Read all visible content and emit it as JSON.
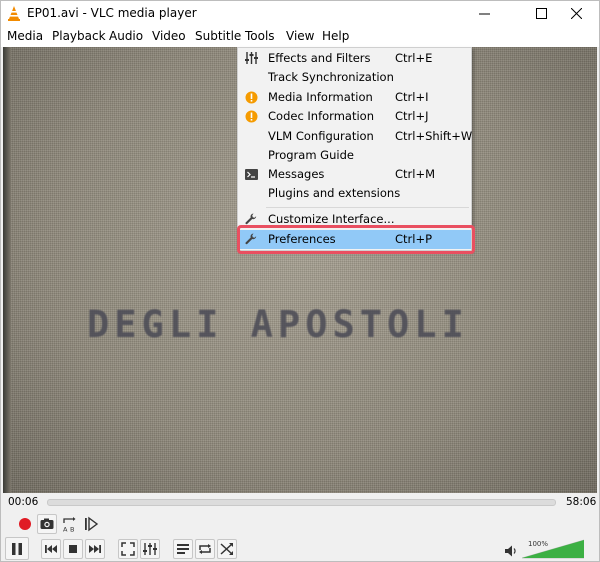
{
  "window": {
    "title": "EP01.avi - VLC media player",
    "controls": {
      "minimize": "minimize-icon",
      "maximize": "maximize-icon",
      "close": "close-icon"
    }
  },
  "menubar": {
    "items": [
      {
        "label": "Media"
      },
      {
        "label": "Playback"
      },
      {
        "label": "Audio"
      },
      {
        "label": "Video"
      },
      {
        "label": "Subtitle"
      },
      {
        "label": "Tools"
      },
      {
        "label": "View"
      },
      {
        "label": "Help"
      }
    ],
    "open_menu": "Tools"
  },
  "video": {
    "caption": "DEGLI  APOSTOLI"
  },
  "tools_menu": {
    "items": [
      {
        "label": "Effects and Filters",
        "shortcut": "Ctrl+E",
        "icon": "equalizer-icon"
      },
      {
        "label": "Track Synchronization",
        "shortcut": "",
        "icon": ""
      },
      {
        "label": "Media Information",
        "shortcut": "Ctrl+I",
        "icon": "info-icon"
      },
      {
        "label": "Codec Information",
        "shortcut": "Ctrl+J",
        "icon": "info-icon"
      },
      {
        "label": "VLM Configuration",
        "shortcut": "Ctrl+Shift+W",
        "icon": ""
      },
      {
        "label": "Program Guide",
        "shortcut": "",
        "icon": ""
      },
      {
        "label": "Messages",
        "shortcut": "Ctrl+M",
        "icon": "terminal-icon"
      },
      {
        "label": "Plugins and extensions",
        "shortcut": "",
        "icon": ""
      },
      {
        "label": "Customize Interface...",
        "shortcut": "",
        "icon": "wrench-icon"
      },
      {
        "label": "Preferences",
        "shortcut": "Ctrl+P",
        "icon": "wrench-icon",
        "highlighted": true
      }
    ]
  },
  "seek": {
    "elapsed": "00:06",
    "total": "58:06",
    "progress": 0.0
  },
  "controls_row1": [
    "record-icon",
    "snapshot-icon",
    "loop-ab-icon",
    "frame-step-icon"
  ],
  "controls_row2": [
    "pause-icon",
    "previous-icon",
    "stop-icon",
    "next-icon",
    "fullscreen-icon",
    "extended-settings-icon",
    "playlist-icon",
    "loop-icon",
    "shuffle-icon"
  ],
  "volume": {
    "percent_label": "100%",
    "level": 1.0,
    "icon": "speaker-icon"
  },
  "colors": {
    "accent_highlight": "#91c9f7",
    "callout_frame": "#e94f60",
    "volume_fill": "#3cb043",
    "record": "#e01b24"
  }
}
